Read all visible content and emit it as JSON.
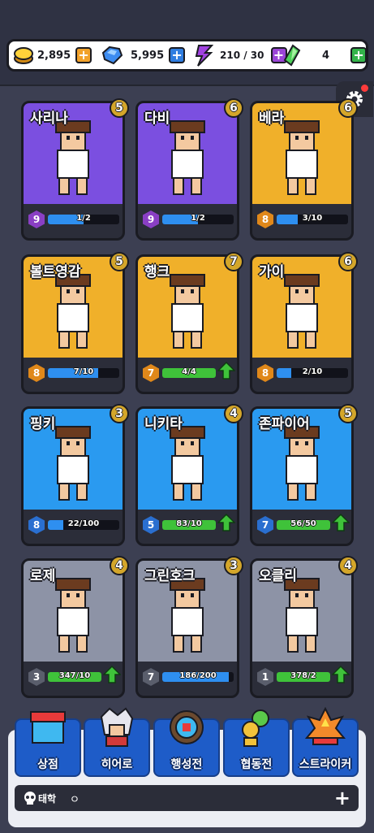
{
  "resources": {
    "gold": {
      "value": "2,895",
      "icon": "gold-coin-icon",
      "plus_color": "#f2a22b"
    },
    "gems": {
      "value": "5,995",
      "icon": "blue-gem-icon",
      "plus_color": "#2f7de0"
    },
    "energy": {
      "value": "210 / 30",
      "icon": "purple-lightning-icon",
      "plus_color": "#9a45d6"
    },
    "green": {
      "value": "4",
      "icon": "green-crystal-icon",
      "plus_color": "#33b44a"
    }
  },
  "heroes": [
    {
      "name": "사리나",
      "stars": "5",
      "level": "9",
      "progress": "1/2",
      "fill": 0.5,
      "bg": "#7b4fe0",
      "lvl_color": "#8a3fc4",
      "bar_color": "#2e8ff0",
      "upgrade": false
    },
    {
      "name": "다비",
      "stars": "6",
      "level": "9",
      "progress": "1/2",
      "fill": 0.5,
      "bg": "#7b4fe0",
      "lvl_color": "#8a3fc4",
      "bar_color": "#2e8ff0",
      "upgrade": false
    },
    {
      "name": "베라",
      "stars": "6",
      "level": "8",
      "progress": "3/10",
      "fill": 0.3,
      "bg": "#f0b02a",
      "lvl_color": "#e0881a",
      "bar_color": "#2e8ff0",
      "upgrade": false
    },
    {
      "name": "볼트영감",
      "stars": "5",
      "level": "8",
      "progress": "7/10",
      "fill": 0.7,
      "bg": "#f0b02a",
      "lvl_color": "#e0881a",
      "bar_color": "#2e8ff0",
      "upgrade": false
    },
    {
      "name": "행크",
      "stars": "7",
      "level": "7",
      "progress": "4/4",
      "fill": 1.0,
      "bg": "#f0b02a",
      "lvl_color": "#e0881a",
      "bar_color": "#3fc23a",
      "upgrade": true
    },
    {
      "name": "가이",
      "stars": "6",
      "level": "8",
      "progress": "2/10",
      "fill": 0.2,
      "bg": "#f0b02a",
      "lvl_color": "#e0881a",
      "bar_color": "#2e8ff0",
      "upgrade": false
    },
    {
      "name": "핑키",
      "stars": "3",
      "level": "8",
      "progress": "22/100",
      "fill": 0.22,
      "bg": "#2a9af0",
      "lvl_color": "#2a6fd0",
      "bar_color": "#2e8ff0",
      "upgrade": false
    },
    {
      "name": "니키타",
      "stars": "4",
      "level": "5",
      "progress": "83/10",
      "fill": 1.0,
      "bg": "#2a9af0",
      "lvl_color": "#2a6fd0",
      "bar_color": "#3fc23a",
      "upgrade": true
    },
    {
      "name": "존파이어",
      "stars": "5",
      "level": "7",
      "progress": "56/50",
      "fill": 1.0,
      "bg": "#2a9af0",
      "lvl_color": "#2a6fd0",
      "bar_color": "#3fc23a",
      "upgrade": true
    },
    {
      "name": "로제",
      "stars": "4",
      "level": "3",
      "progress": "347/10",
      "fill": 1.0,
      "bg": "#8d93a6",
      "lvl_color": "#5a5e6c",
      "bar_color": "#3fc23a",
      "upgrade": true
    },
    {
      "name": "그린호크",
      "stars": "3",
      "level": "7",
      "progress": "186/200",
      "fill": 0.93,
      "bg": "#8d93a6",
      "lvl_color": "#5a5e6c",
      "bar_color": "#2e8ff0",
      "upgrade": false
    },
    {
      "name": "오클리",
      "stars": "4",
      "level": "1",
      "progress": "378/2",
      "fill": 1.0,
      "bg": "#8d93a6",
      "lvl_color": "#5a5e6c",
      "bar_color": "#3fc23a",
      "upgrade": true
    }
  ],
  "nav_tabs": [
    {
      "label": "상점",
      "icon": "shop-icon",
      "color": "#1e5cc8"
    },
    {
      "label": "히어로",
      "icon": "hero-icon",
      "color": "#1e5cc8"
    },
    {
      "label": "행성전",
      "icon": "planet-icon",
      "color": "#1e5cc8"
    },
    {
      "label": "협동전",
      "icon": "coop-icon",
      "color": "#1e5cc8"
    },
    {
      "label": "스트라이커",
      "icon": "striker-icon",
      "color": "#1e5cc8"
    }
  ],
  "chat": {
    "label": "태학",
    "message": "ㅇ"
  },
  "colors": {
    "star_badge": "#d4a62a",
    "upgrade_arrow": "#3fc23a",
    "settings_badge": "#ff3b3b"
  }
}
